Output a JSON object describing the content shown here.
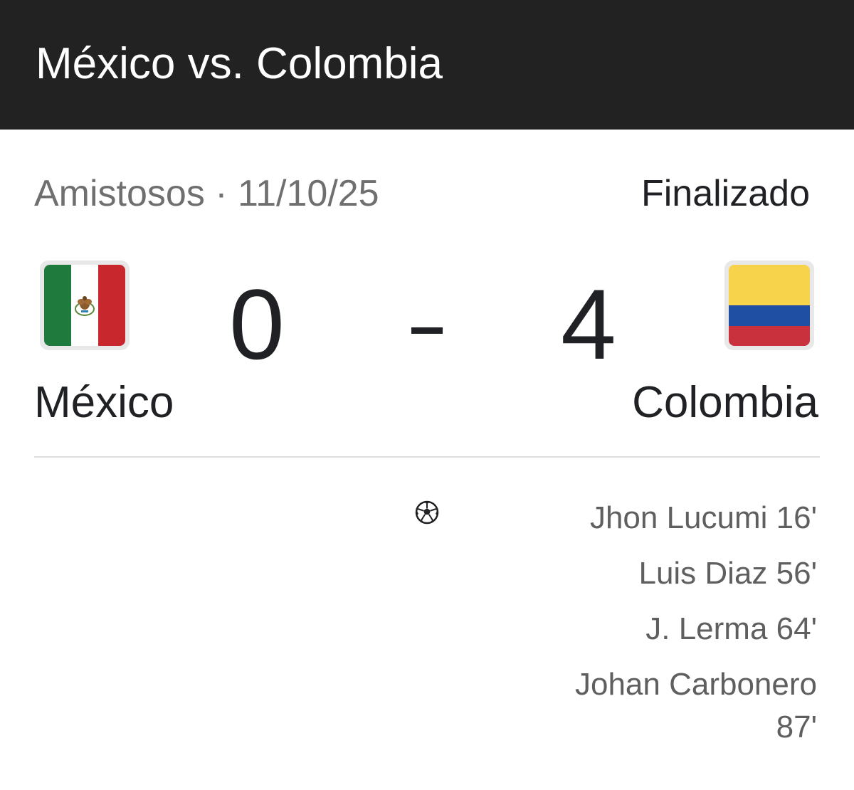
{
  "header": {
    "title": "México vs. Colombia"
  },
  "match": {
    "competition_date": "Amistosos · 11/10/25",
    "status": "Finalizado",
    "score_separator": "-"
  },
  "home": {
    "name": "México",
    "score": "0",
    "flag_icon": "mexico-flag-icon",
    "flag_colors": [
      "#1f7a3e",
      "#ffffff",
      "#c8282d"
    ]
  },
  "away": {
    "name": "Colombia",
    "score": "4",
    "flag_icon": "colombia-flag-icon",
    "flag_colors": [
      "#f6d34a",
      "#1f4fa3",
      "#c9313d"
    ]
  },
  "goal_icon": "soccer-ball-icon",
  "scorers": [
    {
      "text": "Jhon Lucumi 16'"
    },
    {
      "text": "Luis Diaz 56'"
    },
    {
      "text": "J. Lerma 64'"
    },
    {
      "text": "Johan Carbonero 87'"
    }
  ]
}
